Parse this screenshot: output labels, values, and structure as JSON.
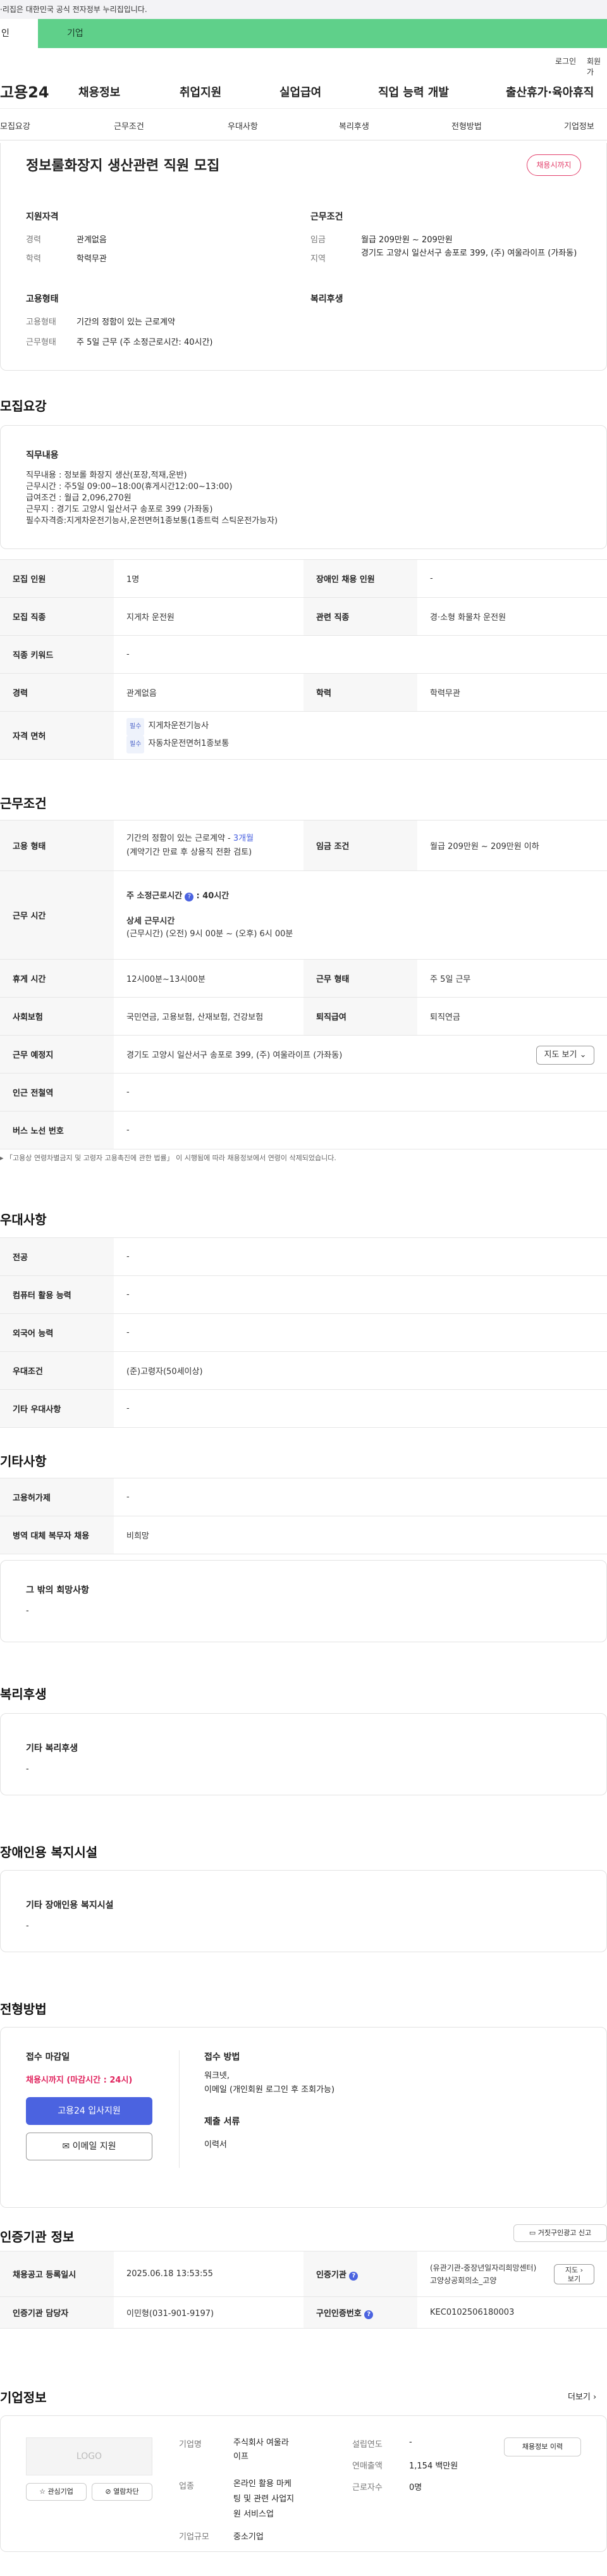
{
  "gov_banner": "이 누리집은 대한민국 공식 전자정부 누리집입니다.",
  "gov_banner_shown": "·리집은 대한민국 공식 전자정부 누리집입니다.",
  "tabs": {
    "personal": "인",
    "company": "기업"
  },
  "util": {
    "login": "로그인",
    "join": "회원가"
  },
  "gnb": {
    "logo": "고용24",
    "items": [
      "채용정보",
      "취업지원",
      "실업급여",
      "직업 능력 개발",
      "출산휴가·육아휴직"
    ]
  },
  "anchor": [
    "모집요강",
    "근무조건",
    "우대사항",
    "복리후생",
    "전형방법",
    "기업정보"
  ],
  "summary": {
    "title": "정보룰화장지 생산관련 직원 모집",
    "badge": "채용시까지",
    "qual_title": "지원자격",
    "cond_title": "근무조건",
    "career_label": "경력",
    "career": "관계없음",
    "edu_label": "학력",
    "edu": "학력무관",
    "wage_label": "임금",
    "wage": "월급 209만원 ~ 209만원",
    "region_label": "지역",
    "region": "경기도 고양시 일산서구 송포로 399, (주) 여울라이프 (가좌동)",
    "emp_title": "고용형태",
    "welfare_title": "복리후생",
    "emp_type_label": "고용형태",
    "emp_type": "기간의 정함이 있는 근로계약",
    "work_type_label": "근무형태",
    "work_type": "주 5일 근무 (주 소정근로시간: 40시간)"
  },
  "recruit": {
    "heading": "모집요강",
    "duty_title": "직무내용",
    "duty_lines": [
      "직무내용 : 정보롤 화장지 생산(포장,적재,운반)",
      "근무시간 : 주5일 09:00~18:00(휴게시간12:00~13:00)",
      "급여조건 : 월급 2,096,270원",
      "근무지 : 경기도 고양시 일산서구 송포로 399 (가좌동)",
      "필수자격증:지게차운전기능사,운전면허1종보통(1종트럭 스틱운전가능자)"
    ],
    "rows": [
      {
        "k1": "모집 인원",
        "v1": "1명",
        "k2": "장애인 채용 인원",
        "v2": "-"
      },
      {
        "k1": "모집 직종",
        "v1": "지게차 운전원",
        "k2": "관련 직종",
        "v2": "경·소형 화물차 운전원"
      },
      {
        "k1": "직종 키워드",
        "v1": "-"
      },
      {
        "k1": "경력",
        "v1": "관계없음",
        "k2": "학력",
        "v2": "학력무관"
      }
    ],
    "license_label": "자격 면허",
    "required_chip": "필수",
    "licenses": [
      "지게차운전기능사",
      "자동차운전면허1종보통"
    ]
  },
  "conditions": {
    "heading": "근무조건",
    "emp_label": "고용 형태",
    "emp_value": "기간의 정함이 있는 근로계약 - ",
    "emp_period": "3개월",
    "emp_note": "(계약기간 만료 후 상용직 전환 검토)",
    "wage_label": "임금 조건",
    "wage_value": "월급 209만원 ~ 209만원 이하",
    "hours_label": "근무 시간",
    "weekly_hours_title": "주 소정근로시간",
    "weekly_hours": ": 40시간",
    "detail_title": "상세 근무시간",
    "detail_value": "(근무시간) (오전) 9시 00분 ~ (오후) 6시 00분",
    "rest_label": "휴게 시간",
    "rest_value": "12시00분~13시00분",
    "form_label": "근무 형태",
    "form_value": "주 5일 근무",
    "insurance_label": "사회보험",
    "insurance_value": "국민연금, 고용보험, 산재보험, 건강보험",
    "pension_label": "퇴직급여",
    "pension_value": "퇴직연금",
    "place_label": "근무 예정지",
    "place_value": "경기도 고양시 일산서구 송포로 399, (주) 여울라이프 (가좌동)",
    "map_button": "지도 보기",
    "subway_label": "인근 전철역",
    "subway_value": "-",
    "bus_label": "버스 노선 번호",
    "bus_value": "-",
    "footnote": "「고용상 연령차별금지 및 고령자 고용촉진에 관한 법률」 이 시행됨에 따라 채용정보에서 연령이 삭제되었습니다."
  },
  "pref": {
    "heading": "우대사항",
    "rows": [
      [
        "전공",
        "-"
      ],
      [
        "컴퓨터 활용 능력",
        "-"
      ],
      [
        "외국어 능력",
        "-"
      ],
      [
        "우대조건",
        "(준)고령자(50세이상)"
      ],
      [
        "기타 우대사항",
        "-"
      ]
    ]
  },
  "etc": {
    "heading": "기타사항",
    "rows": [
      [
        "고용허가제",
        "-"
      ],
      [
        "병역 대체 복무자 채용",
        "비희망"
      ]
    ],
    "other_title": "그 밖의 희망사항",
    "other_value": "-"
  },
  "welfare": {
    "heading": "복리후생",
    "title": "기타 복리후생",
    "value": "-"
  },
  "disabled": {
    "heading": "장애인용 복지시설",
    "title": "기타 장애인용 복지시설",
    "value": "-"
  },
  "screening": {
    "heading": "전형방법",
    "deadline_title": "접수 마감일",
    "deadline_value": "채용시까지 (마감시간 : 24시)",
    "apply_button": "고용24 입사지원",
    "email_button": "이메일 지원",
    "method_title": "접수 방법",
    "method_lines": [
      "워크넷,",
      "이메일 (개인회원 로그인 후 조회가능)"
    ],
    "docs_title": "제출 서류",
    "docs_value": "이력서"
  },
  "cert": {
    "heading": "인증기관 정보",
    "report_button": "거짓구인광고 신고",
    "reg_label": "채용공고 등록일시",
    "reg_value": "2025.06.18 13:53:55",
    "org_label": "인증기관",
    "org_value_1": "(유관기관-중장년일자리희망센터)",
    "org_value_2": "고양상공회의소_고양",
    "map_button_1": "지도",
    "map_button_2": "보기",
    "staff_label": "인증기관 담당자",
    "staff_value": "이민형(031-901-9197)",
    "id_label": "구인인증번호",
    "id_value": "KEC0102506180003"
  },
  "company": {
    "heading": "기업정보",
    "more": "더보기",
    "logo": "LOGO",
    "interest_button": "관심기업",
    "block_button": "열람차단",
    "name_label": "기업명",
    "name_lines": [
      "주식회사 여울라",
      "이프"
    ],
    "industry_label": "업종",
    "industry_lines": [
      "온라인 활용 마케",
      "팅 및 관련 사업지",
      "원 서비스업"
    ],
    "scale_label": "기업규모",
    "scale_value": "중소기업",
    "year_label": "설립연도",
    "year_value": "-",
    "sales_label": "연매출액",
    "sales_value": "1,154 백만원",
    "staff_label": "근로자수",
    "staff_value": "0명",
    "jobs_button": "채용정보 이력"
  },
  "colors": {
    "brand_green": "#5fd08a",
    "primary_blue": "#4b63e0",
    "badge_pink": "#e3406b",
    "deadline_red": "#e0245e"
  }
}
